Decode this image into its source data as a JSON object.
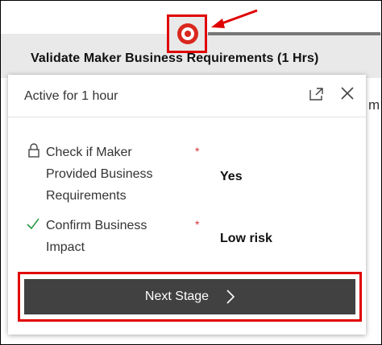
{
  "stage": {
    "title": "Validate Maker Business Requirements  (1 Hrs)",
    "side_text": "m"
  },
  "flyout": {
    "active_text": "Active for 1 hour",
    "fields": [
      {
        "label_lines": [
          "Check if Maker",
          "Provided Business",
          "Requirements"
        ],
        "required": "*",
        "value": "Yes",
        "icon": "lock-icon"
      },
      {
        "label_lines": [
          "Confirm Business",
          "Impact"
        ],
        "required": "*",
        "value": "Low risk",
        "icon": "check-icon"
      }
    ],
    "next_button_label": "Next Stage"
  },
  "colors": {
    "annotation_red": "#e00000",
    "stage_marker_red": "#d9281f",
    "button_dark": "#414141",
    "required_red": "#d13438",
    "check_green": "#2e9a48"
  }
}
